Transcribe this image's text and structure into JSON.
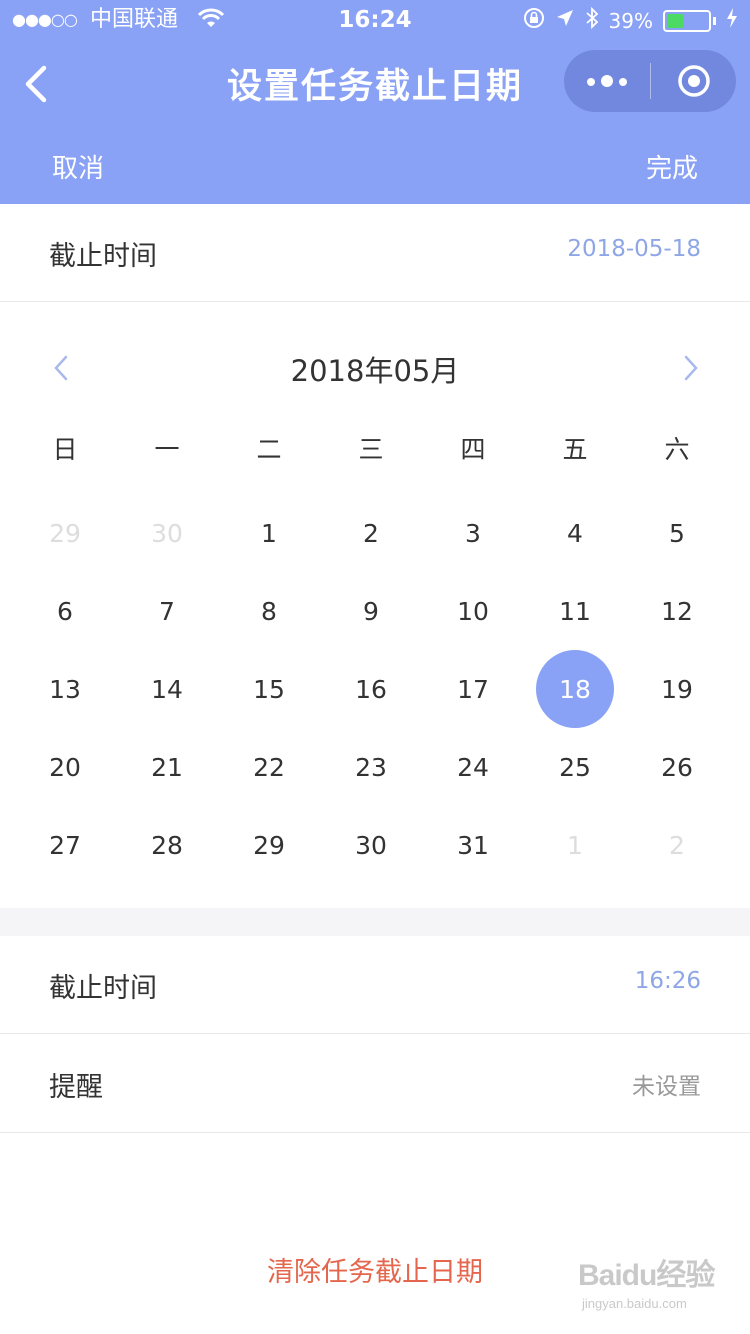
{
  "status_bar": {
    "signal": "●●●○○",
    "carrier": "中国联通",
    "time": "16:24",
    "battery_percent": "39%",
    "battery_level": 0.39
  },
  "nav": {
    "title": "设置任务截止日期"
  },
  "actions": {
    "cancel": "取消",
    "done": "完成"
  },
  "deadline_date": {
    "label": "截止时间",
    "value": "2018-05-18"
  },
  "calendar": {
    "title": "2018年05月",
    "weekdays": [
      "日",
      "一",
      "二",
      "三",
      "四",
      "五",
      "六"
    ],
    "weeks": [
      [
        {
          "d": "29",
          "other": true
        },
        {
          "d": "30",
          "other": true
        },
        {
          "d": "1"
        },
        {
          "d": "2"
        },
        {
          "d": "3"
        },
        {
          "d": "4"
        },
        {
          "d": "5"
        }
      ],
      [
        {
          "d": "6"
        },
        {
          "d": "7"
        },
        {
          "d": "8"
        },
        {
          "d": "9"
        },
        {
          "d": "10"
        },
        {
          "d": "11"
        },
        {
          "d": "12"
        }
      ],
      [
        {
          "d": "13"
        },
        {
          "d": "14"
        },
        {
          "d": "15"
        },
        {
          "d": "16"
        },
        {
          "d": "17"
        },
        {
          "d": "18",
          "selected": true
        },
        {
          "d": "19"
        }
      ],
      [
        {
          "d": "20"
        },
        {
          "d": "21"
        },
        {
          "d": "22"
        },
        {
          "d": "23"
        },
        {
          "d": "24"
        },
        {
          "d": "25"
        },
        {
          "d": "26"
        }
      ],
      [
        {
          "d": "27"
        },
        {
          "d": "28"
        },
        {
          "d": "29"
        },
        {
          "d": "30"
        },
        {
          "d": "31"
        },
        {
          "d": "1",
          "other": true
        },
        {
          "d": "2",
          "other": true
        }
      ]
    ]
  },
  "deadline_time": {
    "label": "截止时间",
    "value": "16:26"
  },
  "reminder": {
    "label": "提醒",
    "value": "未设置"
  },
  "clear_button": "清除任务截止日期",
  "watermark": {
    "logo": "Baidu经验",
    "url": "jingyan.baidu.com"
  },
  "colors": {
    "accent": "#8aa2f5",
    "value_blue": "#8ea6e6",
    "danger": "#e4674d",
    "muted": "#999999",
    "other_month": "#dddddd"
  }
}
